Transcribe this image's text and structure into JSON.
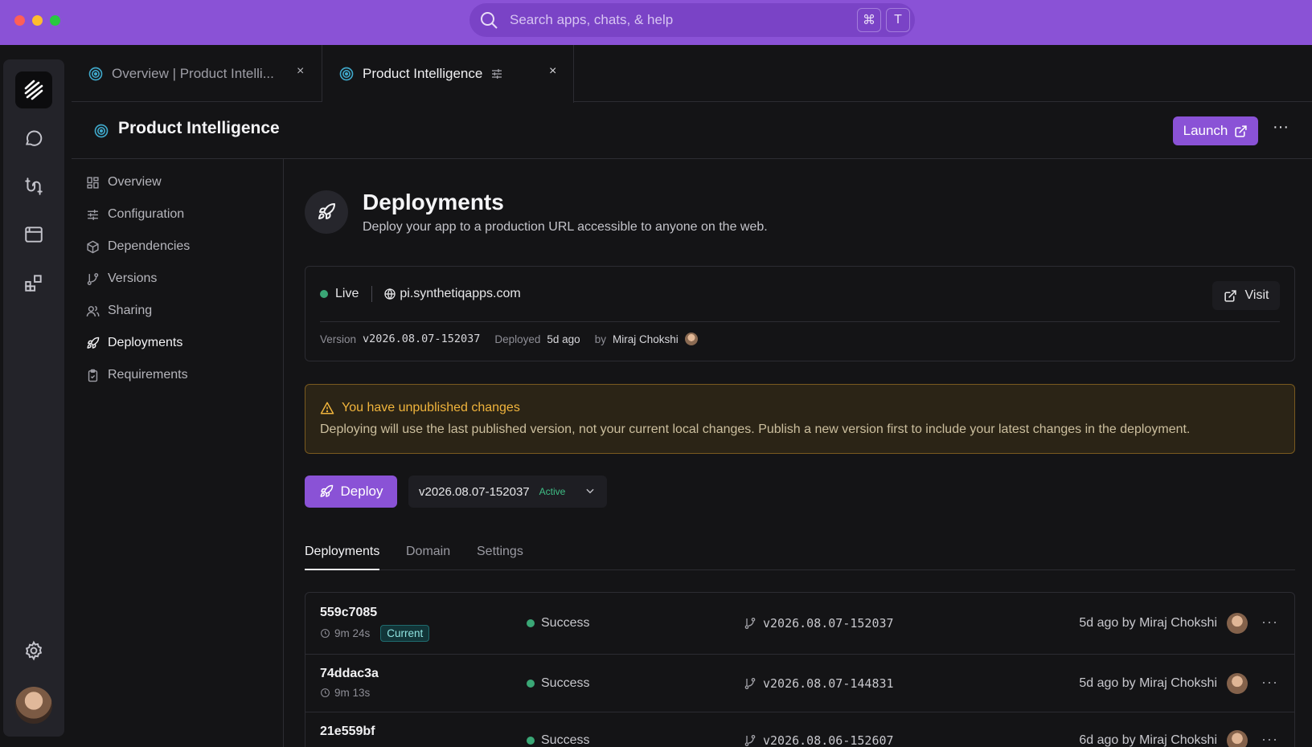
{
  "window": {
    "search_placeholder": "Search apps, chats, & help",
    "shortcut_keys": [
      "⌘",
      "T"
    ],
    "traffic_colors": [
      "#ff5f57",
      "#febc2e",
      "#28c840"
    ],
    "accent": "#8a52d6"
  },
  "tabs": [
    {
      "label": "Overview | Product Intelli...",
      "close": "×"
    },
    {
      "label": "Product Intelligence",
      "close": "×"
    }
  ],
  "page_header": {
    "title": "Product Intelligence",
    "launch_label": "Launch",
    "more": "···"
  },
  "sidebar": {
    "items": [
      {
        "label": "Overview",
        "icon": "grid-icon"
      },
      {
        "label": "Configuration",
        "icon": "sliders-icon"
      },
      {
        "label": "Dependencies",
        "icon": "package-icon"
      },
      {
        "label": "Versions",
        "icon": "git-branch-icon"
      },
      {
        "label": "Sharing",
        "icon": "users-icon"
      },
      {
        "label": "Deployments",
        "icon": "rocket-icon",
        "active": true
      },
      {
        "label": "Requirements",
        "icon": "clipboard-icon"
      }
    ]
  },
  "deployments": {
    "title": "Deployments",
    "subtitle": "Deploy your app to a production URL accessible to anyone on the web.",
    "live": {
      "status": "Live",
      "domain": "pi.synthetiqapps.com",
      "visit_label": "Visit",
      "version_label": "Version",
      "version": "v2026.08.07-152037",
      "deployed_label": "Deployed",
      "deployed_ago": "5d ago",
      "by_label": "by",
      "author": "Miraj Chokshi"
    },
    "warning": {
      "title": "You have unpublished changes",
      "body": "Deploying will use the last published version, not your current local changes. Publish a new version first to include your latest changes in the deployment."
    },
    "deploy_label": "Deploy",
    "version_select": {
      "value": "v2026.08.07-152037",
      "badge": "Active"
    },
    "subtabs": [
      "Deployments",
      "Domain",
      "Settings"
    ],
    "rows": [
      {
        "id": "559c7085",
        "duration": "9m 24s",
        "badge": "Current",
        "status": "Success",
        "version": "v2026.08.07-152037",
        "by": "5d ago by Miraj Chokshi",
        "more": "···"
      },
      {
        "id": "74ddac3a",
        "duration": "9m 13s",
        "badge": "",
        "status": "Success",
        "version": "v2026.08.07-144831",
        "by": "5d ago by Miraj Chokshi",
        "more": "···"
      },
      {
        "id": "21e559bf",
        "duration": "",
        "badge": "",
        "status": "Success",
        "version": "v2026.08.06-152607",
        "by": "6d ago by Miraj Chokshi",
        "more": "···"
      }
    ]
  }
}
